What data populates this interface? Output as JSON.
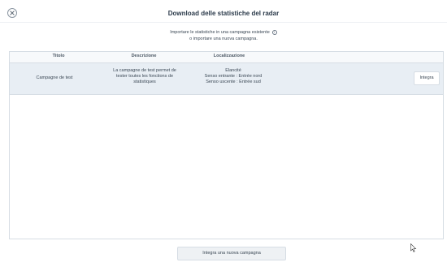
{
  "header": {
    "title": "Download delle statistiche del radar",
    "close_icon": "close-circle-icon"
  },
  "intro": {
    "line1": "Importare le statistiche in una campagna esistente",
    "line2": "o importare una nuova campagna.",
    "info_icon": "info-icon"
  },
  "table": {
    "columns": [
      "Titolo",
      "Descrizione",
      "Localizzazione"
    ],
    "rows": [
      {
        "title": "Campagne de test",
        "description_line1": "La campagne de test permet de",
        "description_line2": "tester toutes les fonctions de",
        "description_line3": "statistiques",
        "location_line1": "Elancité",
        "location_line2": "Senso entrante : Entrée nord",
        "location_line3": "Senso uscente : Entrée sud",
        "action_label": "Integra"
      }
    ]
  },
  "footer": {
    "new_campaign_label": "Integra una nuova campagna"
  }
}
